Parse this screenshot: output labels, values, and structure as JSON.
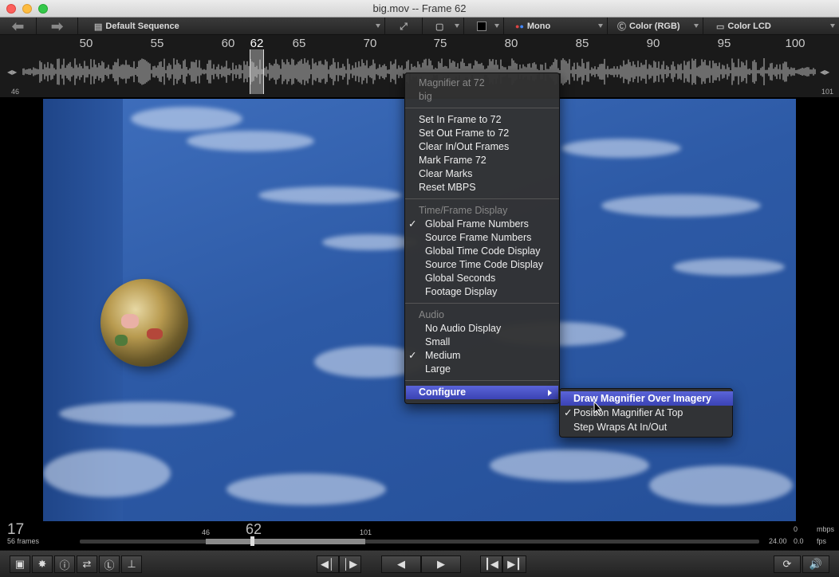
{
  "window": {
    "title": "big.mov -- Frame 62"
  },
  "toolbar": {
    "sequence_label": "Default Sequence",
    "channels_label": "Mono",
    "color_mode_label": "Color (RGB)",
    "display_label": "Color LCD"
  },
  "timeline": {
    "ruler_numbers": [
      "50",
      "55",
      "60",
      "62",
      "65",
      "70",
      "75",
      "80",
      "85",
      "90",
      "95",
      "100"
    ],
    "start_frame": "46",
    "end_frame": "101"
  },
  "context_menu": {
    "header_title": "Magnifier at 72",
    "header_sub": "big",
    "actions": [
      "Set In Frame to 72",
      "Set Out Frame to 72",
      "Clear In/Out Frames",
      "Mark Frame 72",
      "Clear Marks",
      "Reset MBPS"
    ],
    "time_section_title": "Time/Frame Display",
    "time_items": [
      "Global Frame Numbers",
      "Source Frame Numbers",
      "Global Time Code Display",
      "Source Time Code Display",
      "Global Seconds",
      "Footage Display"
    ],
    "audio_section_title": "Audio",
    "audio_items": [
      "No Audio Display",
      "Small",
      "Medium",
      "Large"
    ],
    "configure_label": "Configure"
  },
  "submenu": {
    "items": [
      "Draw Magnifier Over Imagery",
      "Position Magnifier At Top",
      "Step Wraps At In/Out"
    ]
  },
  "status": {
    "big_frame": "17",
    "frames_count": "56 frames",
    "range_start": "46",
    "range_current": "62",
    "range_end": "101",
    "mbps_value": "0",
    "mbps_unit": "mbps",
    "fps_target": "24.00",
    "fps_actual": "0.0",
    "fps_unit": "fps"
  },
  "icons": {
    "back": "back-arrow-icon",
    "forward": "forward-arrow-icon",
    "check": "checkmark-icon"
  },
  "colors": {
    "menu_highlight": "#3b43b5",
    "viewer_blue": "#2d5aa6"
  }
}
